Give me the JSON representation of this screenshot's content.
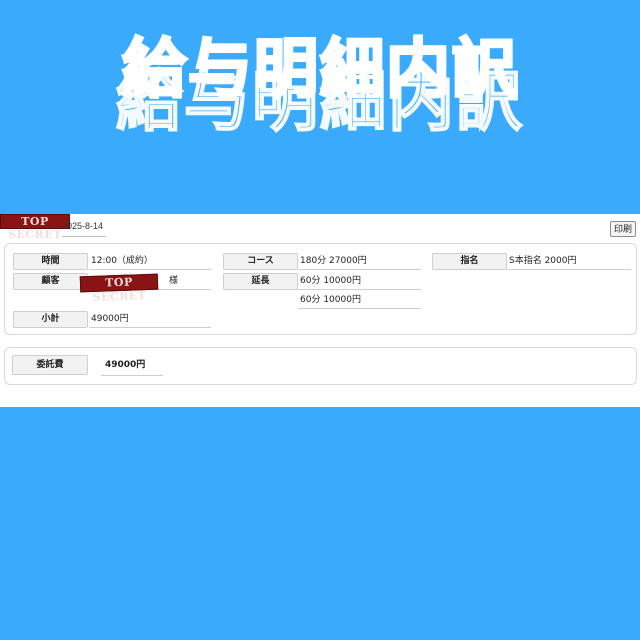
{
  "headline": {
    "title": "給与明細内訳"
  },
  "header": {
    "date": "2025-8-14",
    "print_label": "印刷",
    "stamp_text": "TOP SECRET"
  },
  "details": {
    "time": {
      "label": "時間",
      "value": "12:00（成約）"
    },
    "customer": {
      "label": "顧客",
      "value": "様",
      "redaction": "TOP SECRET"
    },
    "subtotal": {
      "label": "小計",
      "value": "49000円"
    },
    "course": {
      "label": "コース",
      "value": "180分 27000円"
    },
    "extension": {
      "label": "延長",
      "values": [
        "60分 10000円",
        "60分 10000円"
      ]
    },
    "nomination": {
      "label": "指名",
      "value": "S本指名 2000円"
    }
  },
  "fee": {
    "label": "委託費",
    "value": "49000円"
  }
}
